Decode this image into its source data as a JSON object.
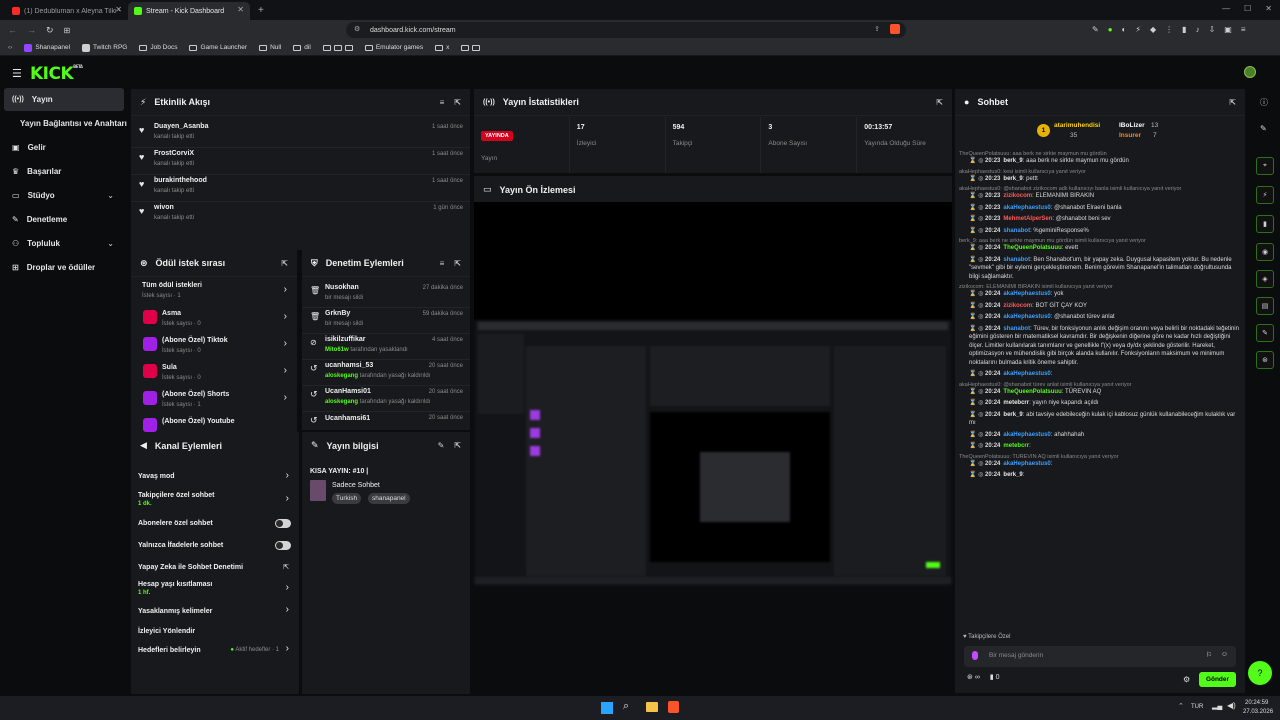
{
  "browser": {
    "tabs": [
      {
        "label": "(1) Dedubluman x Aleyna Tilki - Y"
      },
      {
        "label": "Stream - Kick Dashboard"
      }
    ],
    "url": "dashboard.kick.com/stream",
    "bookmarks": [
      "Shanapanel",
      "Twitch RPG",
      "Job Docs",
      "Game Launcher",
      "Null",
      "dil",
      "Emulator games",
      "x"
    ]
  },
  "kick": {
    "logo": "KICK",
    "beta": "BETA"
  },
  "sidebar": {
    "items": [
      {
        "label": "Yayın",
        "icon": "broadcast-icon"
      },
      {
        "label": "Yayın Bağlantısı ve Anahtarı",
        "icon": ""
      },
      {
        "label": "Gelir",
        "icon": "wallet-icon"
      },
      {
        "label": "Başarılar",
        "icon": "trophy-icon"
      },
      {
        "label": "Stüdyo",
        "icon": "monitor-icon"
      },
      {
        "label": "Denetleme",
        "icon": "wrench-icon"
      },
      {
        "label": "Topluluk",
        "icon": "community-icon"
      },
      {
        "label": "Droplar ve ödüller",
        "icon": "gift-icon"
      }
    ]
  },
  "activity": {
    "title": "Etkinlik Akışı",
    "items": [
      {
        "name": "Duayen_Asanba",
        "desc": "kanalı takip etti",
        "time": "1 saat önce"
      },
      {
        "name": "FrostCorviX",
        "desc": "kanalı takip etti",
        "time": "1 saat önce"
      },
      {
        "name": "burakinthehood",
        "desc": "kanalı takip etti",
        "time": "1 saat önce"
      },
      {
        "name": "wivon",
        "desc": "kanalı takip etti",
        "time": "1 gün önce"
      }
    ]
  },
  "stats": {
    "title": "Yayın İstatistikleri",
    "live_badge": "YAYINDA",
    "cells": [
      {
        "value": "",
        "label": "Yayın"
      },
      {
        "value": "17",
        "label": "İzleyici"
      },
      {
        "value": "594",
        "label": "Takipçi"
      },
      {
        "value": "3",
        "label": "Abone Sayısı"
      },
      {
        "value": "00:13:57",
        "label": "Yayında Olduğu Süre"
      }
    ]
  },
  "preview": {
    "title": "Yayın Ön İzlemesi"
  },
  "rewards": {
    "title": "Ödül istek sırası",
    "all": {
      "name": "Tüm ödül istekleri",
      "count": "İstek sayısı · 1"
    },
    "items": [
      {
        "name": "Asma",
        "count": "İstek sayısı · 0"
      },
      {
        "name": "(Abone Özel) Tiktok",
        "count": "İstek sayısı · 0"
      },
      {
        "name": "Sula",
        "count": "İstek sayısı · 0"
      },
      {
        "name": "(Abone Özel) Shorts",
        "count": "İstek sayısı · 1"
      },
      {
        "name": "(Abone Özel) Youtube",
        "count": ""
      }
    ]
  },
  "moderation": {
    "title": "Denetim Eylemleri",
    "items": [
      {
        "name": "Nusokhan",
        "who": "",
        "desc": "bir mesajı sildi",
        "time": "27 dakika önce"
      },
      {
        "name": "GrknBy",
        "who": "",
        "desc": "bir mesajı sildi",
        "time": "59 dakika önce"
      },
      {
        "name": "isikilzuffikar",
        "who": "Mito61w",
        "desc": "tarafından yasaklandı",
        "time": "4 saat önce"
      },
      {
        "name": "ucanhamsi_53",
        "who": "aloskegang",
        "desc": "tarafından yasağı kaldırıldı",
        "time": "20 saat önce"
      },
      {
        "name": "UcanHamsi01",
        "who": "aloskegang",
        "desc": "tarafından yasağı kaldırıldı",
        "time": "20 saat önce"
      },
      {
        "name": "Ucanhamsi61",
        "who": "",
        "desc": "",
        "time": "20 saat önce"
      }
    ]
  },
  "channel_actions": {
    "title": "Kanal Eylemleri",
    "items": [
      {
        "label": "Yavaş mod",
        "sub": "",
        "ctrl": "arrow"
      },
      {
        "label": "Takipçilere özel sohbet",
        "sub": "1 dk.",
        "ctrl": "arrow"
      },
      {
        "label": "Abonelere özel sohbet",
        "sub": "",
        "ctrl": "toggle"
      },
      {
        "label": "Yalnızca İfadelerle sohbet",
        "sub": "",
        "ctrl": "toggle"
      },
      {
        "label": "Yapay Zeka ile Sohbet Denetimi",
        "sub": "",
        "ctrl": "ext"
      },
      {
        "label": "Hesap yaşı kısıtlaması",
        "sub": "1 hf.",
        "ctrl": "arrow"
      },
      {
        "label": "Yasaklanmış kelimeler",
        "sub": "",
        "ctrl": "arrow"
      },
      {
        "label": "İzleyici Yönlendir",
        "sub": "",
        "ctrl": ""
      },
      {
        "label": "Hedefleri belirleyin",
        "sub": "",
        "ctrl": "arrow",
        "extra": "Aktif hedefler · 1"
      }
    ]
  },
  "stream_info": {
    "title": "Yayın bilgisi",
    "stream_title": "KISA YAYIN: #10 |",
    "category": "Sadece Sohbet",
    "tags": [
      "Turkish",
      "shanapanel"
    ]
  },
  "chat": {
    "title": "Sohbet",
    "leaders": [
      {
        "name": "atarimuhendisi",
        "value": "35",
        "rank": "1"
      },
      {
        "name": "IBoLizer",
        "value": "13",
        "rank": ""
      },
      {
        "name": "Insurer",
        "value": "7",
        "rank": ""
      }
    ],
    "messages": [
      {
        "reply": "TheQueenPolatsuuu: aaa berk ne sirkte maymun mu gördün",
        "time": "20:23",
        "user": "berk_9",
        "ucolor": "#e8e8e8",
        "text": "aaa berk ne sirkte maymun mu gördün"
      },
      {
        "reply": "akaHephaestus0: kesi isimli kullanıcıya yanıt veriyor",
        "time": "20:23",
        "user": "berk_9",
        "ucolor": "#e8e8e8",
        "text": "pettt"
      },
      {
        "reply": "akaHephaestus0: @shanabot zizikocom adlı kullanıcıyı banla isimli kullanıcıya yanıt veriyor",
        "time": "20:23",
        "user": "zizikocom",
        "ucolor": "#ff5a5a",
        "text": "ELEMANIMI BIRAKIN"
      },
      {
        "reply": "",
        "time": "20:23",
        "user": "akaHephaestus0",
        "ucolor": "#3aa0ff",
        "text": "@shanabot Elraeni banla"
      },
      {
        "reply": "",
        "time": "20:23",
        "user": "MehmetAlperSen",
        "ucolor": "#ff5a5a",
        "text": "@shanabot beni sev"
      },
      {
        "reply": "",
        "time": "20:24",
        "user": "shanabot",
        "ucolor": "#3aa0ff",
        "text": "%geminiResponse%"
      },
      {
        "reply": "berk_9: aaa berk ne sirkte maymun mu gördün isimli kullanıcıya yanıt veriyor",
        "time": "20:24",
        "user": "TheQueenPolatsuuu",
        "ucolor": "#53fc18",
        "text": "evett"
      },
      {
        "reply": "",
        "time": "20:24",
        "user": "shanabot",
        "ucolor": "#3aa0ff",
        "text": "Ben Shanabot'um, bir yapay zeka. Duygusal kapasitem yoktur. Bu nedenle \"sevmek\" gibi bir eylemi gerçekleştiremem. Benim görevim Shanapanel'in talimatları doğrultusunda bilgi sağlamaktır."
      },
      {
        "reply": "zizikocom: ELEMANIMI BIRAKIN isimli kullanıcıya yanıt veriyor",
        "time": "20:24",
        "user": "akaHephaestus0",
        "ucolor": "#3aa0ff",
        "text": "yok"
      },
      {
        "reply": "",
        "time": "20:24",
        "user": "zizikocom",
        "ucolor": "#ff5a5a",
        "text": "BOT GİT ÇAY KOY"
      },
      {
        "reply": "",
        "time": "20:24",
        "user": "akaHephaestus0",
        "ucolor": "#3aa0ff",
        "text": "@shanabot türev anlat"
      },
      {
        "reply": "",
        "time": "20:24",
        "user": "shanabot",
        "ucolor": "#3aa0ff",
        "text": "Türev, bir fonksiyonun anlık değişim oranını veya belirli bir noktadaki teğetinin eğimini gösteren bir matematiksel kavramdır. Bir değişkenin diğerine göre ne kadar hızlı değiştiğini ölçer. Limitler kullanılarak tanımlanır ve genellikle f'(x) veya dy/dx şeklinde gösterilir. Hareket, optimizasyon ve mühendislik gibi birçok alanda kullanılır. Fonksiyonların maksimum ve minimum noktalarını bulmada kritik öneme sahiptir."
      },
      {
        "reply": "",
        "time": "20:24",
        "user": "akaHephaestus0",
        "ucolor": "#3aa0ff",
        "text": ""
      },
      {
        "reply": "akaHephaestus0: @shanabot türev anlat isimli kullanıcıya yanıt veriyor",
        "time": "20:24",
        "user": "TheQueenPolatsuuu",
        "ucolor": "#53fc18",
        "text": "TÜREVIN AQ"
      },
      {
        "reply": "",
        "time": "20:24",
        "user": "metebcrr",
        "ucolor": "#e8e8e8",
        "text": "yayın niye kapandı açıldı"
      },
      {
        "reply": "",
        "time": "20:24",
        "user": "berk_9",
        "ucolor": "#e8e8e8",
        "text": "abi tavsiye edebileceğin kulak içi kablosuz günlük kullanabileceğim kulaklık var mı"
      },
      {
        "reply": "",
        "time": "20:24",
        "user": "akaHephaestus0",
        "ucolor": "#3aa0ff",
        "text": "ahahhahah"
      },
      {
        "reply": "",
        "time": "20:24",
        "user": "metebcrr",
        "ucolor": "#53fc18",
        "text": ""
      },
      {
        "reply": "TheQueenPolatsuuu: TÜREVIN AQ isimli kullanıcıya yanıt veriyor",
        "time": "20:24",
        "user": "akaHephaestus0",
        "ucolor": "#3aa0ff",
        "text": ""
      },
      {
        "reply": "",
        "time": "20:24",
        "user": "berk_9",
        "ucolor": "#e8e8e8",
        "text": ""
      }
    ],
    "mode_label": "Takipçilere Özel",
    "input_placeholder": "Bir mesaj gönderin",
    "counter_a": "∞",
    "counter_b": "0",
    "send_label": "Gönder"
  },
  "taskbar": {
    "lang": "TUR",
    "time": "20:24:59",
    "date": "27.03.2026"
  },
  "colors": {
    "accent": "#53fc18",
    "panel": "#18191c",
    "bg": "#0b0c0e"
  }
}
